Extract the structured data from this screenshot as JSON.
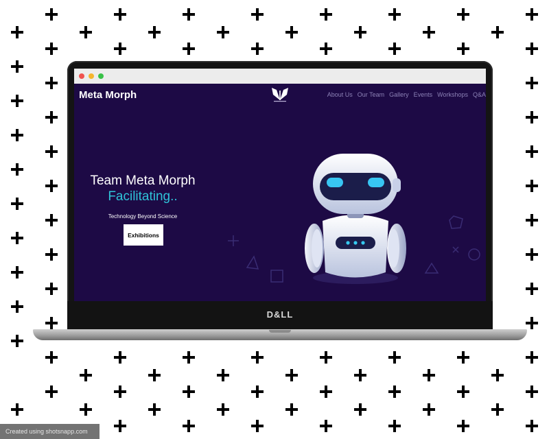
{
  "browser": {
    "dot_colors": [
      "#f0524f",
      "#f5b52e",
      "#39c148"
    ]
  },
  "site": {
    "brand": "Meta Morph",
    "logo_icon": "butterfly-logo-icon",
    "nav": [
      "About Us",
      "Our Team",
      "Gallery",
      "Events",
      "Workshops",
      "Q&A"
    ],
    "hero": {
      "title": "Team Meta Morph",
      "subtitle": "Facilitating..",
      "tagline": "Technology Beyond Science",
      "cta_label": "Exhibitions"
    },
    "accent_color": "#2fc3d8",
    "background_color": "#1d0a45"
  },
  "laptop": {
    "brand_mark": "D&LL"
  },
  "footer": {
    "credit": "Created using shotsnapp.com"
  }
}
